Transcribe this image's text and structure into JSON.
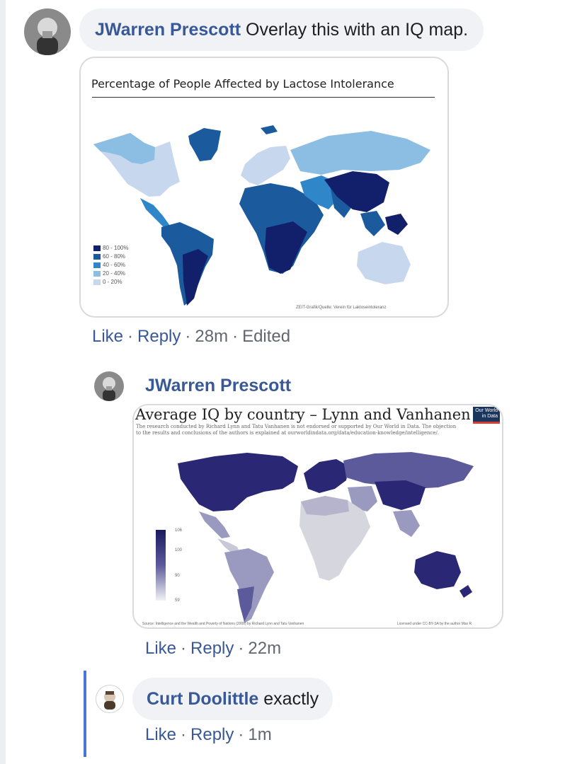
{
  "comments": [
    {
      "author": "JWarren Prescott",
      "text": "Overlay this with an IQ map.",
      "time": "28m",
      "edited": "Edited",
      "image": {
        "title": "Percentage of People Affected by Lactose Intolerance",
        "legend": [
          "80 - 100%",
          "60 - 80%",
          "40 - 60%",
          "20 - 40%",
          "0 - 20%"
        ],
        "credit": "ZEIT-Grafik/Quelle: Verein für Laktoseintoleranz",
        "colors": [
          "#12206b",
          "#1a5a9d",
          "#2f86c9",
          "#8cbde3",
          "#c7d8ee"
        ]
      }
    },
    {
      "author": "JWarren Prescott",
      "time": "22m",
      "image": {
        "title": "Average IQ by country – Lynn and Vanhanen",
        "description": "The research conducted by Richard Lynn and Tatu Vanhanen is not endorsed or supported by Our World in Data. The objection to the results and conclusions of the authors is explained at ourworldindata.org/data/education-knowledge/intelligence/.",
        "badge": "Our World in Data",
        "scale": [
          "106",
          "100",
          "90",
          "59"
        ],
        "source": "Source: Intelligence and the Wealth and Poverty of Nations (2006) by Richard Lynn and Tatu Vanhanen",
        "license": "Licensed under CC-BY-SA by the author Max R",
        "colors": [
          "#2a2775",
          "#5c5a9a",
          "#9a99bf",
          "#d6d6df"
        ]
      }
    },
    {
      "author": "Curt Doolittle",
      "text": "exactly",
      "time": "1m"
    }
  ],
  "actions": {
    "like": "Like",
    "reply": "Reply",
    "dot": "·"
  }
}
